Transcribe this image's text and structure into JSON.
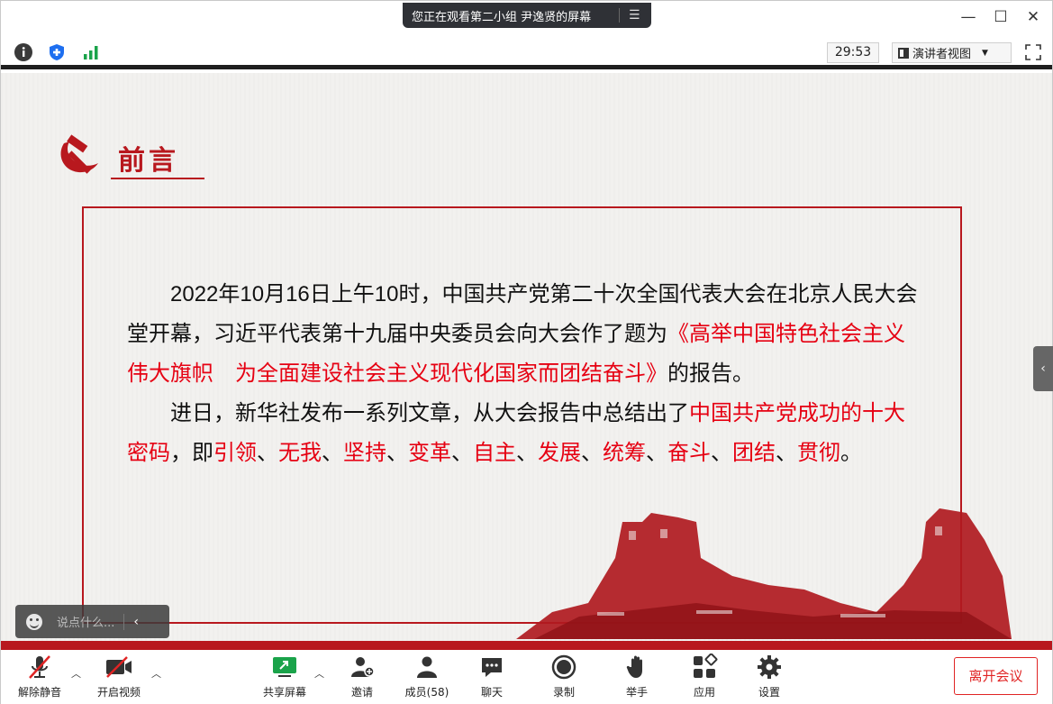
{
  "window": {
    "share_banner": "您正在观看第二小组 尹逸贤的屏幕",
    "controls": [
      "—",
      "☐",
      "✕"
    ]
  },
  "toolbar": {
    "timer": "29:53",
    "view_label": "演讲者视图"
  },
  "slide": {
    "heading": "前言",
    "para1_text": "2022年10月16日上午10时，中国共产党第二十次全国代表大会在北京人民大会堂开幕，习近平代表第十九届中央委员会向大会作了题为",
    "para1_title": "《高举中国特色社会主义伟大旗帜　为全面建设社会主义现代化国家而团结奋斗》",
    "para1_tail": "的报告。",
    "para2_text": "进日，新华社发布一系列文章，从大会报告中总结出了",
    "para2_highlight": "中国共产党成功的十大密码",
    "para2_ji": "，即",
    "codes": [
      "引领",
      "无我",
      "坚持",
      "变革",
      "自主",
      "发展",
      "统筹",
      "奋斗",
      "团结",
      "贯彻"
    ],
    "code_sep": "、",
    "para2_end": "。",
    "accent_color": "#b8181e",
    "highlight_color": "#e60012"
  },
  "chat_input": {
    "placeholder": "说点什么..."
  },
  "bottom": {
    "mute": "解除静音",
    "video": "开启视频",
    "share": "共享屏幕",
    "invite": "邀请",
    "members": "成员(58)",
    "chat": "聊天",
    "record": "录制",
    "raise_hand": "举手",
    "apps": "应用",
    "settings": "设置",
    "leave": "离开会议"
  }
}
